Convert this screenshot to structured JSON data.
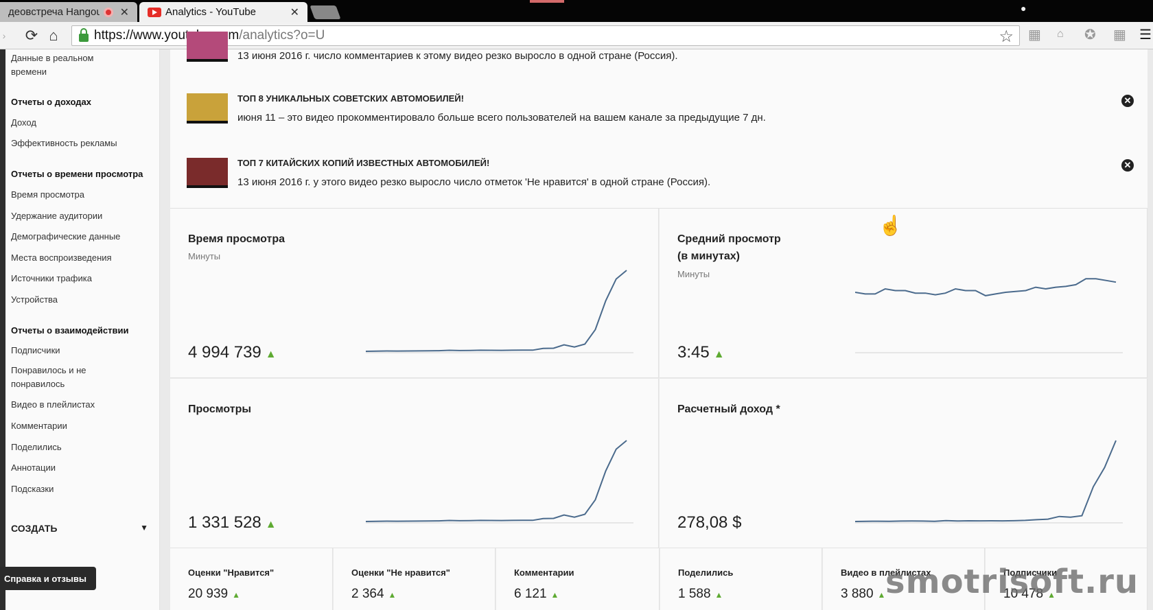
{
  "browser": {
    "tabs": [
      {
        "label": "деовстреча Hangouts",
        "active": false
      },
      {
        "label": "Analytics - YouTube",
        "active": true
      }
    ],
    "url_host": "https://www.youtube.com",
    "url_path": "/analytics?o=U"
  },
  "sidebar": {
    "items": [
      {
        "label": "Данные в реальном времени",
        "heading": false
      },
      {
        "label": "Отчеты о доходах",
        "heading": true
      },
      {
        "label": "Доход",
        "heading": false
      },
      {
        "label": "Эффективность рекламы",
        "heading": false
      },
      {
        "label": "Отчеты о времени просмотра",
        "heading": true
      },
      {
        "label": "Время просмотра",
        "heading": false
      },
      {
        "label": "Удержание аудитории",
        "heading": false
      },
      {
        "label": "Демографические данные",
        "heading": false
      },
      {
        "label": "Места воспроизведения",
        "heading": false
      },
      {
        "label": "Источники трафика",
        "heading": false
      },
      {
        "label": "Устройства",
        "heading": false
      },
      {
        "label": "Отчеты о взаимодействии",
        "heading": true
      },
      {
        "label": "Подписчики",
        "heading": false
      },
      {
        "label": "Понравилось и не понравилось",
        "heading": false
      },
      {
        "label": "Видео в плейлистах",
        "heading": false
      },
      {
        "label": "Комментарии",
        "heading": false
      },
      {
        "label": "Поделились",
        "heading": false
      },
      {
        "label": "Аннотации",
        "heading": false
      },
      {
        "label": "Подсказки",
        "heading": false
      }
    ],
    "create_label": "СОЗДАТЬ",
    "help_label": "Справка и отзывы"
  },
  "notifications": [
    {
      "title": "",
      "desc": "13 июня 2016 г. число комментариев к этому видео резко выросло в одной стране (Россия)."
    },
    {
      "title": "ТОП 8 УНИКАЛЬНЫХ СОВЕТСКИХ АВТОМОБИЛЕЙ!",
      "desc": "июня 11 – это видео прокомментировало больше всего пользователей на вашем канале за предыдущие 7 дн."
    },
    {
      "title": "ТОП 7 КИТАЙСКИХ КОПИЙ ИЗВЕСТНЫХ АВТОМОБИЛЕЙ!",
      "desc": "13 июня 2016 г. у этого видео резко выросло число отметок 'Не нравится' в одной стране (Россия)."
    }
  ],
  "metrics": {
    "watch_time": {
      "title": "Время просмотра",
      "unit": "Минуты",
      "value": "4 994 739",
      "trend": "▲"
    },
    "avg_view": {
      "title": "Средний просмотр (в минутах)",
      "unit": "Минуты",
      "value": "3:45",
      "trend": "▲"
    },
    "views": {
      "title": "Просмотры",
      "value": "1 331 528",
      "trend": "▲"
    },
    "revenue": {
      "title": "Расчетный доход *",
      "value": "278,08 $"
    }
  },
  "small_metrics": [
    {
      "label": "Оценки \"Нравится\"",
      "value": "20 939",
      "trend": "▲"
    },
    {
      "label": "Оценки \"Не нравится\"",
      "value": "2 364",
      "trend": "▲"
    },
    {
      "label": "Комментарии",
      "value": "6 121",
      "trend": "▲"
    },
    {
      "label": "Поделились",
      "value": "1 588",
      "trend": "▲"
    },
    {
      "label": "Видео в плейлистах",
      "value": "3 880",
      "trend": "▲"
    },
    {
      "label": "Подписчики",
      "value": "10 478",
      "trend": "▲"
    }
  ],
  "watermark": "smotrisoft.ru",
  "chart_data": [
    {
      "type": "line",
      "title": "Время просмотра",
      "series": [
        {
          "name": "Время просмотра",
          "values": [
            0,
            0.3,
            0.5,
            0.4,
            0.5,
            0.6,
            0.7,
            0.9,
            1.4,
            1.0,
            1.2,
            1.5,
            1.4,
            1.3,
            1.5,
            1.6,
            1.6,
            4,
            4.3,
            9,
            6,
            10,
            30,
            70,
            100,
            112
          ]
        }
      ]
    },
    {
      "type": "line",
      "title": "Средний просмотр (в минутах)",
      "series": [
        {
          "name": "Средний просмотр",
          "values": [
            3.5,
            3.4,
            3.4,
            3.7,
            3.6,
            3.6,
            3.45,
            3.45,
            3.35,
            3.45,
            3.7,
            3.6,
            3.6,
            3.3,
            3.4,
            3.5,
            3.55,
            3.6,
            3.8,
            3.7,
            3.8,
            3.85,
            3.95,
            4.3,
            4.3,
            4.2,
            4.1
          ]
        }
      ]
    },
    {
      "type": "line",
      "title": "Просмотры",
      "series": [
        {
          "name": "Просмотры",
          "values": [
            0,
            0.3,
            0.5,
            0.4,
            0.5,
            0.6,
            0.7,
            0.9,
            1.4,
            1.0,
            1.2,
            1.5,
            1.4,
            1.3,
            1.5,
            1.6,
            1.6,
            4,
            4.3,
            9,
            6,
            10,
            30,
            70,
            100,
            112
          ]
        }
      ]
    },
    {
      "type": "line",
      "title": "Расчетный доход *",
      "series": [
        {
          "name": "Доход",
          "values": [
            0,
            0.3,
            0.4,
            0.3,
            0.5,
            0.6,
            0.5,
            0.3,
            1.2,
            0.6,
            0.9,
            0.8,
            0.9,
            0.8,
            1.0,
            1.4,
            2.3,
            3.0,
            6.5,
            5.5,
            7.5,
            45,
            70,
            105
          ]
        }
      ]
    }
  ]
}
